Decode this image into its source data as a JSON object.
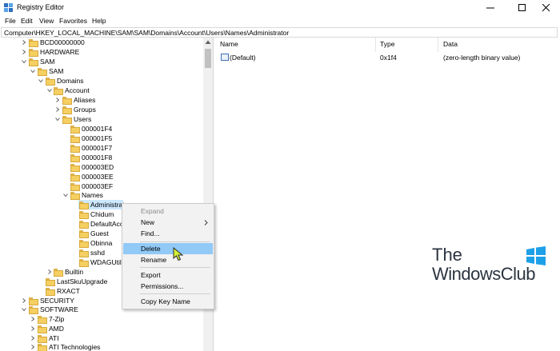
{
  "window": {
    "title": "Registry Editor",
    "minimize_icon": "minimize-icon",
    "maximize_icon": "maximize-icon",
    "close_icon": "close-icon"
  },
  "menu": [
    "File",
    "Edit",
    "View",
    "Favorites",
    "Help"
  ],
  "address": "Computer\\HKEY_LOCAL_MACHINE\\SAM\\SAM\\Domains\\Account\\Users\\Names\\Administrator",
  "tree": {
    "bcd": "BCD00000000",
    "hardware": "HARDWARE",
    "sam": "SAM",
    "sam2": "SAM",
    "domains": "Domains",
    "account": "Account",
    "aliases": "Aliases",
    "groups": "Groups",
    "users": "Users",
    "u1": "000001F4",
    "u2": "000001F5",
    "u3": "000001F7",
    "u4": "000001F8",
    "u5": "000003ED",
    "u6": "000003EE",
    "u7": "000003EF",
    "names": "Names",
    "administrator": "Administrat",
    "chidum": "Chidum",
    "defaultacc": "DefaultAcco",
    "guest": "Guest",
    "obinna": "Obinna",
    "sshd": "sshd",
    "wdag": "WDAGUtilit",
    "builtin": "Builtin",
    "lastsku": "LastSkuUpgrade",
    "rxact": "RXACT",
    "security": "SECURITY",
    "software": "SOFTWARE",
    "zip": "7-Zip",
    "amd": "AMD",
    "ati": "ATI",
    "atitech": "ATI Technologies"
  },
  "list": {
    "headers": {
      "name": "Name",
      "type": "Type",
      "data": "Data"
    },
    "rows": [
      {
        "name": "(Default)",
        "type": "0x1f4",
        "data": "(zero-length binary value)"
      }
    ]
  },
  "context_menu": {
    "expand": "Expand",
    "new": "New",
    "find": "Find...",
    "delete": "Delete",
    "rename": "Rename",
    "export": "Export",
    "permissions": "Permissions...",
    "copy_key": "Copy Key Name"
  },
  "watermark": {
    "line1": "The",
    "line2": "WindowsClub"
  },
  "colors": {
    "selection": "#cce8ff",
    "hover": "#91c9f7",
    "folder": "#f5cf62"
  }
}
